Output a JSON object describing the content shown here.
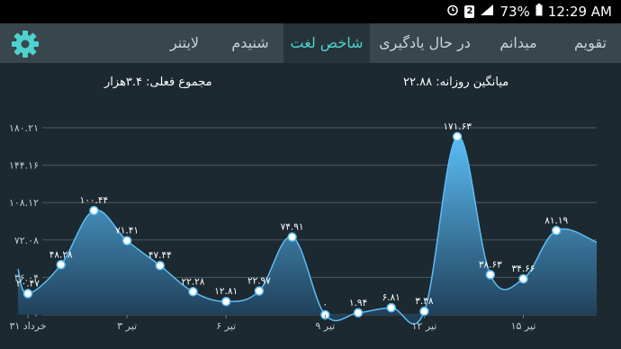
{
  "status_bar": {
    "battery": "73%",
    "time": "12:29 AM",
    "sim": "2"
  },
  "tabs": [
    {
      "label": "تقویم",
      "active": false
    },
    {
      "label": "میدانم",
      "active": false
    },
    {
      "label": "در حال یادگیری",
      "active": false
    },
    {
      "label": "شاخص لغت",
      "active": true
    },
    {
      "label": "شنیدم",
      "active": false
    },
    {
      "label": "لایتنر",
      "active": false
    }
  ],
  "summary": {
    "daily_average": "میانگین روزانه: ۲۲.۸۸",
    "current_total": "مجموع فعلی: ۳.۴هزار"
  },
  "colors": {
    "accent": "#4fd1cf",
    "line": "#5bbdf5",
    "background": "#1d2930",
    "tab_bar": "#37474d"
  },
  "chart_data": {
    "type": "area",
    "y_ticks": [
      "۰",
      "۳۶.۰۴",
      "۷۲.۰۸",
      "۱۰۸.۱۲",
      "۱۴۴.۱۶",
      "۱۸۰.۲۱"
    ],
    "ylim": [
      0,
      180.21
    ],
    "x_ticks": [
      {
        "label": "۳۱ خرداد",
        "day": 1
      },
      {
        "label": "۳ تیر",
        "day": 4
      },
      {
        "label": "۶ تیر",
        "day": 7
      },
      {
        "label": "۹ تیر",
        "day": 10
      },
      {
        "label": "۱۲ تیر",
        "day": 13
      },
      {
        "label": "۱۵ تیر",
        "day": 16
      }
    ],
    "points": [
      {
        "day": 1,
        "value": 20.47,
        "label": "۲۰.۴۷"
      },
      {
        "day": 2,
        "value": 48.28,
        "label": "۴۸.۲۸"
      },
      {
        "day": 3,
        "value": 100.44,
        "label": "۱۰۰.۴۴"
      },
      {
        "day": 4,
        "value": 71.41,
        "label": "۷۱.۴۱"
      },
      {
        "day": 5,
        "value": 47.44,
        "label": "۴۷.۴۴"
      },
      {
        "day": 6,
        "value": 22.28,
        "label": "۲۲.۲۸"
      },
      {
        "day": 7,
        "value": 12.81,
        "label": "۱۲.۸۱"
      },
      {
        "day": 8,
        "value": 22.97,
        "label": "۲۲.۹۷"
      },
      {
        "day": 9,
        "value": 74.91,
        "label": "۷۴.۹۱"
      },
      {
        "day": 10,
        "value": 0,
        "label": "۰"
      },
      {
        "day": 11,
        "value": 1.94,
        "label": "۱.۹۴"
      },
      {
        "day": 12,
        "value": 6.81,
        "label": "۶.۸۱"
      },
      {
        "day": 13,
        "value": 3.38,
        "label": "۳.۳۸"
      },
      {
        "day": 14,
        "value": 171.63,
        "label": "۱۷۱.۶۳"
      },
      {
        "day": 15,
        "value": 38.63,
        "label": "۳۸.۶۳"
      },
      {
        "day": 16,
        "value": 34.66,
        "label": "۳۴.۶۶"
      },
      {
        "day": 17,
        "value": 81.19,
        "label": "۸۱.۱۹"
      }
    ],
    "grid": true
  }
}
